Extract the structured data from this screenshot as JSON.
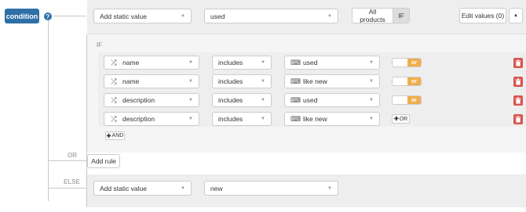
{
  "root": {
    "condition_label": "condition",
    "help_glyph": "?"
  },
  "top": {
    "value_type": "Add static value",
    "value": "used",
    "all_products_label": "All products",
    "if_label": "IF",
    "edit_values_label": "Edit values (0)",
    "collapse_glyph": "▲"
  },
  "if_block": {
    "label": "IF",
    "rules": [
      {
        "field": "name",
        "operator": "includes",
        "value": "used",
        "connector": "or"
      },
      {
        "field": "name",
        "operator": "includes",
        "value": "like new",
        "connector": "or"
      },
      {
        "field": "description",
        "operator": "includes",
        "value": "used",
        "connector": "or"
      },
      {
        "field": "description",
        "operator": "includes",
        "value": "like new",
        "add_or_label": "OR"
      }
    ],
    "add_and_label": "AND"
  },
  "or_label": "OR",
  "add_rule_label": "Add rule",
  "else_block": {
    "label": "ELSE",
    "value_type": "Add static value",
    "value": "new"
  },
  "icons": {
    "field": "shuffle-icon",
    "value": "keyboard-icon",
    "caret": "caret-down-icon",
    "delete": "trash-icon",
    "plus": "plus-icon"
  },
  "colors": {
    "primary": "#2f6fa8",
    "toggle_on": "#f0ad4e",
    "delete": "#d9534f",
    "panel": "#eeeeee"
  }
}
